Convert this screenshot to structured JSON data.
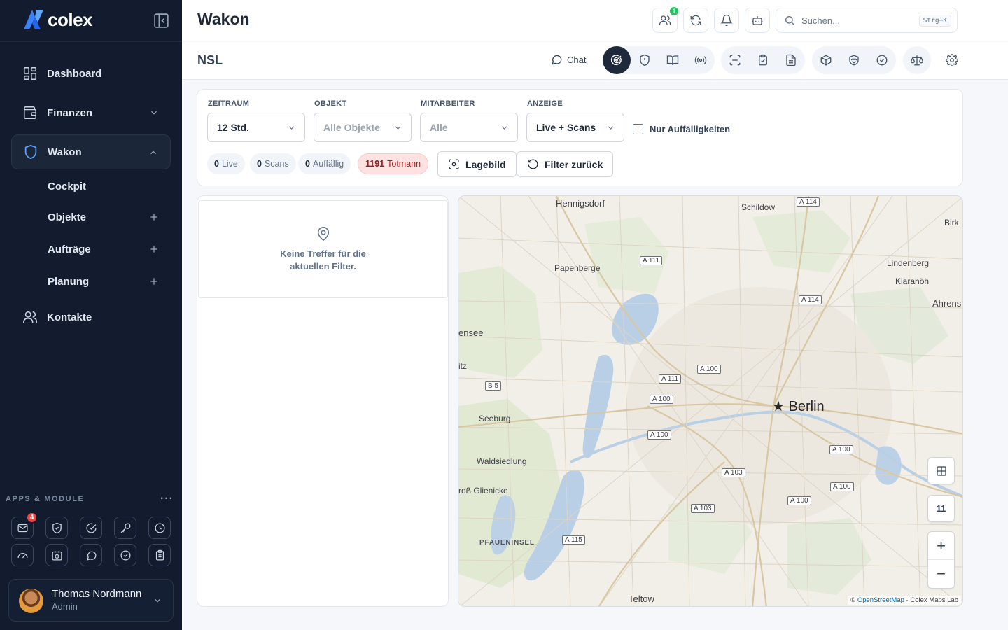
{
  "brand": {
    "name": "colex"
  },
  "sidebar": {
    "items": [
      {
        "label": "Dashboard"
      },
      {
        "label": "Finanzen"
      },
      {
        "label": "Wakon"
      },
      {
        "label": "Kontakte"
      }
    ],
    "subitems": [
      {
        "label": "Cockpit"
      },
      {
        "label": "Objekte"
      },
      {
        "label": "Aufträge"
      },
      {
        "label": "Planung"
      }
    ],
    "apps_title": "APPS & MODULE",
    "apps_more": "···",
    "apps": [
      {
        "icon": "mail-icon",
        "badge": "4"
      },
      {
        "icon": "shield-check-icon"
      },
      {
        "icon": "check-circle-icon"
      },
      {
        "icon": "key-icon"
      },
      {
        "icon": "clock-icon"
      },
      {
        "icon": "gauge-icon"
      },
      {
        "icon": "calendar-clock-icon"
      },
      {
        "icon": "chat-bubble-icon"
      },
      {
        "icon": "badge-check-icon"
      },
      {
        "icon": "clipboard-icon"
      }
    ],
    "user": {
      "name": "Thomas Nordmann",
      "role": "Admin"
    }
  },
  "header": {
    "title": "Wakon",
    "users_badge": "1",
    "search_placeholder": "Suchen...",
    "search_shortcut": "Strg+K"
  },
  "subheader": {
    "title": "NSL",
    "chat_label": "Chat"
  },
  "filters": {
    "zeitraum": {
      "label": "ZEITRAUM",
      "value": "12 Std."
    },
    "objekt": {
      "label": "OBJEKT",
      "value": "Alle Objekte"
    },
    "mitarbeiter": {
      "label": "MITARBEITER",
      "value": "Alle"
    },
    "anzeige": {
      "label": "ANZEIGE",
      "value": "Live + Scans"
    },
    "only_anomalies": "Nur Auffälligkeiten"
  },
  "stats": {
    "live": {
      "count": "0",
      "label": "Live"
    },
    "scans": {
      "count": "0",
      "label": "Scans"
    },
    "auffaellig": {
      "count": "0",
      "label": "Auffällig"
    },
    "totmann": {
      "count": "1191",
      "label": "Totmann"
    }
  },
  "actions": {
    "lagebild": "Lagebild",
    "reset": "Filter zurück"
  },
  "list": {
    "empty": "Keine Treffer für die aktuellen Filter."
  },
  "map": {
    "labels": {
      "hennigsdorf": "Hennigsdorf",
      "schildow": "Schildow",
      "birk": "Birk",
      "papenberge": "Papenberge",
      "lindenberg": "Lindenberg",
      "klarahoeh": "Klarahöh",
      "ahrens": "Ahrens",
      "ensee": "ensee",
      "itz": "itz",
      "berlin": "Berlin",
      "seeburg": "Seeburg",
      "waldsiedlung": "Waldsiedlung",
      "gross_glienicke": "roß Glienicke",
      "pfaueninsel": "PFAUENINSEL",
      "teltow": "Teltow"
    },
    "shields": [
      "A 114",
      "A 111",
      "A 114",
      "A 100",
      "A 111",
      "B 5",
      "A 100",
      "A 100",
      "A 100",
      "A 103",
      "A 100",
      "A 103",
      "A 100",
      "A 115"
    ],
    "zoom_level": "11",
    "attribution_prefix": "©",
    "attribution_link": "OpenStreetMap",
    "attribution_suffix": "· Colex Maps Lab"
  }
}
